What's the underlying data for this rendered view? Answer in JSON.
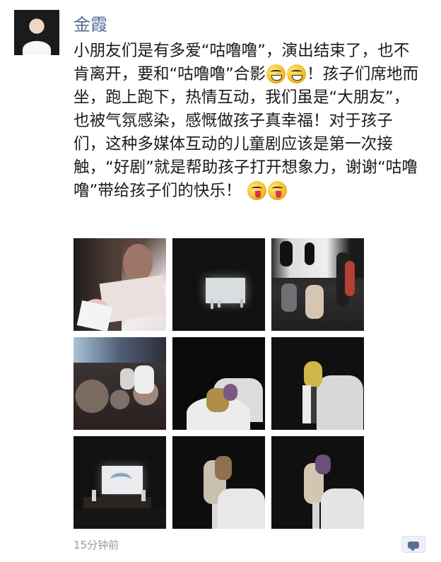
{
  "post": {
    "username": "金霞",
    "text_1": "小朋友们是有多爱“咕噜噜”，演出结束了，也不肯离开，要和“咕噜噜”合影",
    "text_2": "！孩子们席地而坐，跑上跑下，热情互动，我们虽是“大朋友”，也被气氛感染，感慨做孩子真幸福！对于孩子们，这种多媒体互动的儿童剧应该是第一次接触，“好剧”就是帮助孩子打开想象力，谢谢“咕噜噜”带给孩子们的快乐！",
    "emoji_1": "grinning-emoji",
    "emoji_2": "winking-tongue-emoji",
    "time": "15分钟前"
  },
  "colors": {
    "username": "#576b95",
    "text": "#1b1b1b",
    "time": "#9b9b9b",
    "background": "#ffffff"
  },
  "icons": {
    "comment": "comment-bubble-icon"
  }
}
